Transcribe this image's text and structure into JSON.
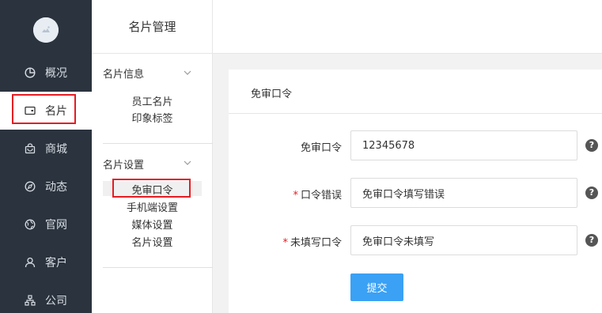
{
  "nav": {
    "items": [
      {
        "label": "概况",
        "icon": "pie-chart-icon"
      },
      {
        "label": "名片",
        "icon": "card-icon",
        "active": true
      },
      {
        "label": "商城",
        "icon": "bag-icon"
      },
      {
        "label": "动态",
        "icon": "compass-icon"
      },
      {
        "label": "官网",
        "icon": "globe-icon"
      },
      {
        "label": "客户",
        "icon": "user-icon"
      },
      {
        "label": "公司",
        "icon": "org-chart-icon"
      }
    ]
  },
  "sidebar": {
    "title": "名片管理",
    "groups": [
      {
        "label": "名片信息",
        "items": [
          "员工名片",
          "印象标签"
        ]
      },
      {
        "label": "名片设置",
        "items": [
          "免审口令",
          "手机端设置",
          "媒体设置",
          "名片设置"
        ]
      }
    ],
    "active_item": "免审口令"
  },
  "panel": {
    "title": "免审口令",
    "fields": [
      {
        "label": "免审口令",
        "required": false,
        "value": "12345678",
        "placeholder": ""
      },
      {
        "label": "口令错误",
        "required": true,
        "value": "免审口令填写错误",
        "placeholder": ""
      },
      {
        "label": "未填写口令",
        "required": true,
        "value": "免审口令未填写",
        "placeholder": ""
      }
    ],
    "submit_label": "提交",
    "help_glyph": "?",
    "required_mark": "*"
  },
  "colors": {
    "nav_bg": "#2b333e",
    "accent": "#3aa1f5",
    "highlight": "#e51c23"
  }
}
